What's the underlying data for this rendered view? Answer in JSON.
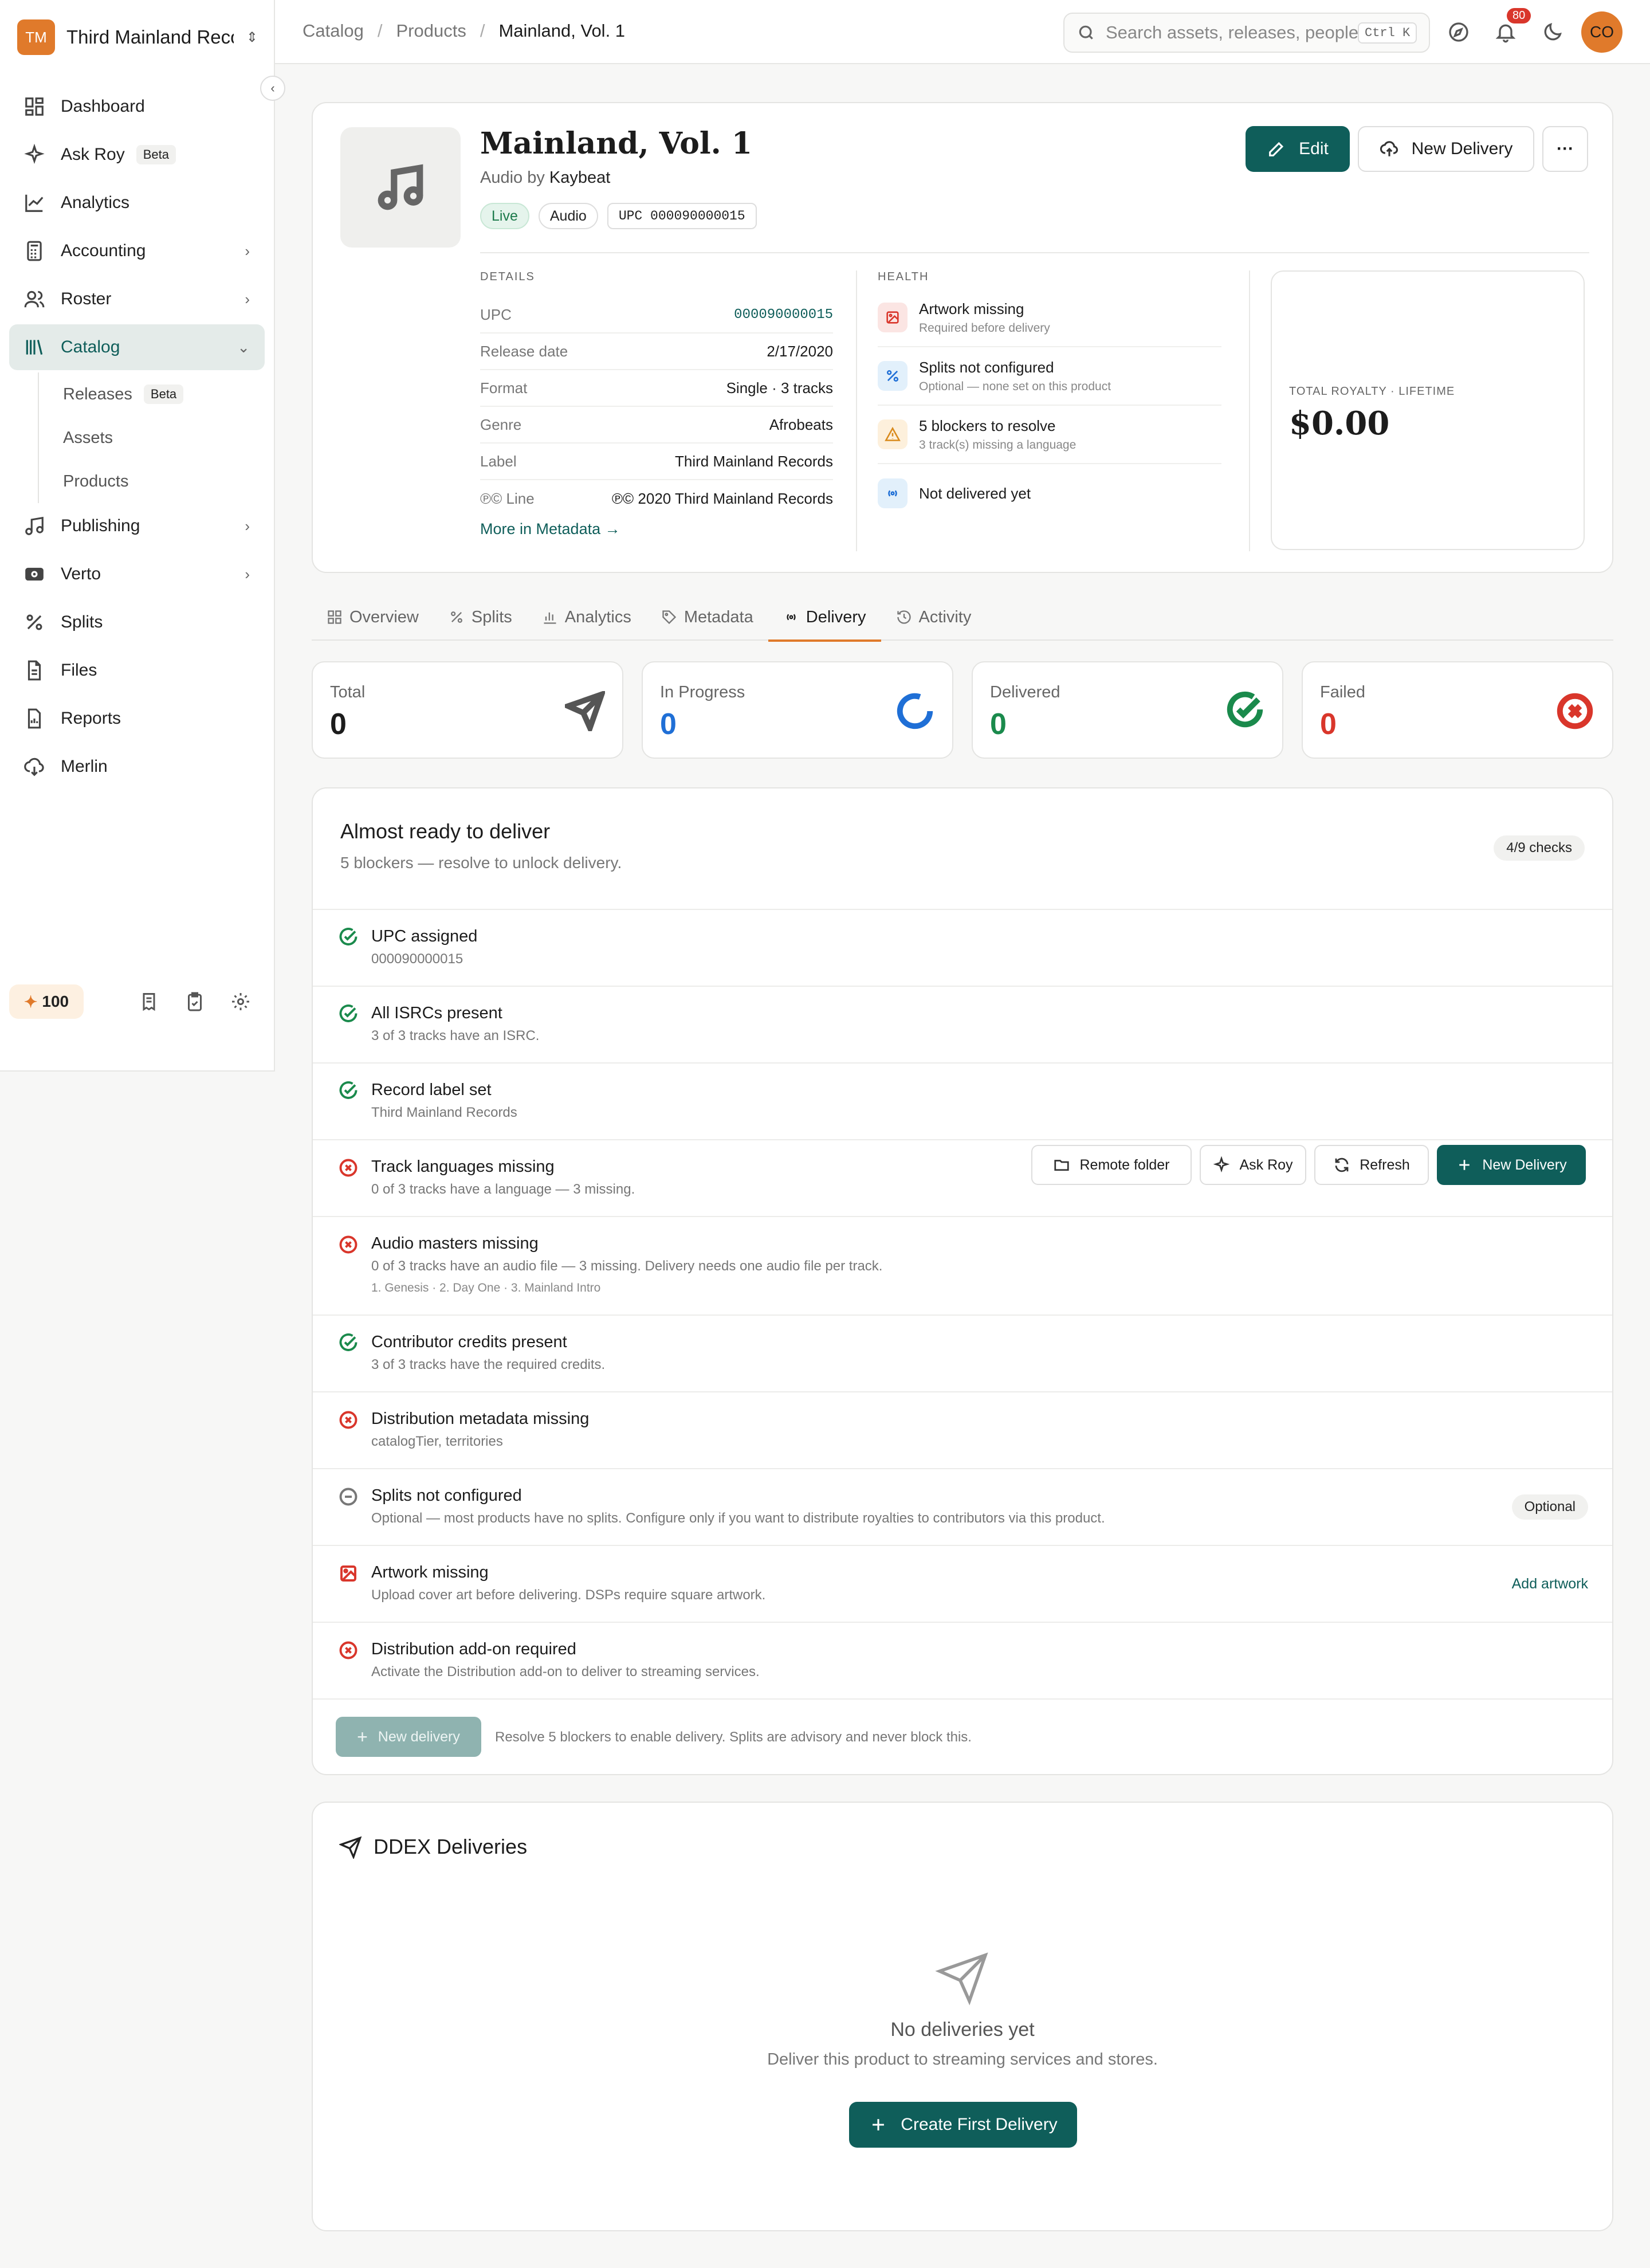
{
  "workspace": {
    "initials": "TM",
    "name": "Third Mainland Reco..."
  },
  "sidebar": {
    "items": [
      {
        "label": "Dashboard"
      },
      {
        "label": "Ask Roy",
        "badge": "Beta"
      },
      {
        "label": "Analytics"
      },
      {
        "label": "Accounting"
      },
      {
        "label": "Roster"
      },
      {
        "label": "Catalog"
      },
      {
        "label": "Publishing"
      },
      {
        "label": "Verto"
      },
      {
        "label": "Splits"
      },
      {
        "label": "Files"
      },
      {
        "label": "Reports"
      },
      {
        "label": "Merlin"
      }
    ],
    "catalog_sub": [
      {
        "label": "Releases",
        "badge": "Beta"
      },
      {
        "label": "Assets"
      },
      {
        "label": "Products"
      }
    ],
    "credits": "100"
  },
  "header": {
    "breadcrumbs": [
      "Catalog",
      "Products",
      "Mainland, Vol. 1"
    ],
    "search_placeholder": "Search assets, releases, people...",
    "shortcut": "Ctrl K",
    "notifications": "80",
    "avatar": "CO"
  },
  "product": {
    "title": "Mainland, Vol. 1",
    "by_prefix": "Audio by",
    "artist": "Kaybeat",
    "chips": [
      "Live",
      "Audio",
      "UPC 000090000015"
    ],
    "edit_label": "Edit",
    "new_delivery_label": "New Delivery",
    "more_label": "···",
    "details_heading": "DETAILS",
    "details": [
      {
        "k": "UPC",
        "v": "000090000015"
      },
      {
        "k": "Release date",
        "v": "2/17/2020"
      },
      {
        "k": "Format",
        "v": "Single · 3 tracks"
      },
      {
        "k": "Genre",
        "v": "Afrobeats"
      },
      {
        "k": "Label",
        "v": "Third Mainland Records"
      },
      {
        "k": "℗© Line",
        "v": "℗© 2020 Third Mainland Records"
      }
    ],
    "more_metadata": "More in Metadata →",
    "health_heading": "HEALTH",
    "health": [
      {
        "t": "Artwork missing",
        "s": "Required before delivery"
      },
      {
        "t": "Splits not configured",
        "s": "Optional — none set on this product"
      },
      {
        "t": "5 blockers to resolve",
        "s": "3 track(s) missing a language"
      },
      {
        "t": "Not delivered yet",
        "s": ""
      }
    ],
    "royalty_label": "TOTAL ROYALTY · LIFETIME",
    "royalty_value": "$0.00"
  },
  "tabs": [
    "Overview",
    "Splits",
    "Analytics",
    "Metadata",
    "Delivery",
    "Activity"
  ],
  "stats": [
    {
      "label": "Total",
      "value": "0"
    },
    {
      "label": "In Progress",
      "value": "0"
    },
    {
      "label": "Delivered",
      "value": "0"
    },
    {
      "label": "Failed",
      "value": "0"
    }
  ],
  "ready": {
    "title": "Almost ready to deliver",
    "subtitle": "5 blockers — resolve to unlock delivery.",
    "checks_badge": "4/9 checks",
    "checks": [
      {
        "status": "ok",
        "t": "UPC assigned",
        "s": "000090000015"
      },
      {
        "status": "ok",
        "t": "All ISRCs present",
        "s": "3 of 3 tracks have an ISRC."
      },
      {
        "status": "ok",
        "t": "Record label set",
        "s": "Third Mainland Records"
      },
      {
        "status": "fail",
        "t": "Track languages missing",
        "s": "0 of 3 tracks have a language — 3 missing."
      },
      {
        "status": "fail",
        "t": "Audio masters missing",
        "s": "0 of 3 tracks have an audio file — 3 missing. Delivery needs one audio file per track.",
        "x": "1. Genesis · 2. Day One · 3. Mainland Intro"
      },
      {
        "status": "ok",
        "t": "Contributor credits present",
        "s": "3 of 3 tracks have the required credits."
      },
      {
        "status": "fail",
        "t": "Distribution metadata missing",
        "s": "catalogTier, territories"
      },
      {
        "status": "optional",
        "t": "Splits not configured",
        "s": "Optional — most products have no splits. Configure only if you want to distribute royalties to contributors via this product.",
        "tag": "Optional"
      },
      {
        "status": "artwork",
        "t": "Artwork missing",
        "s": "Upload cover art before delivering. DSPs require square artwork.",
        "action": "Add artwork"
      },
      {
        "status": "fail",
        "t": "Distribution add-on required",
        "s": "Activate the Distribution add-on to deliver to streaming services."
      }
    ],
    "new_delivery_label": "New delivery",
    "footer_note": "Resolve 5 blockers to enable delivery. Splits are advisory and never block this."
  },
  "ddex": {
    "title": "DDEX Deliveries",
    "remote_folder": "Remote folder",
    "ask_roy": "Ask Roy",
    "refresh": "Refresh",
    "new_delivery": "New Delivery",
    "empty_title": "No deliveries yet",
    "empty_sub": "Deliver this product to streaming services and stores.",
    "create_first": "Create First Delivery"
  },
  "colors": {
    "accent": "#0f5e5a",
    "brand": "#e07a2b",
    "ok": "#1a8a4c",
    "fail": "#d9362b",
    "progress": "#1f6fd6"
  }
}
